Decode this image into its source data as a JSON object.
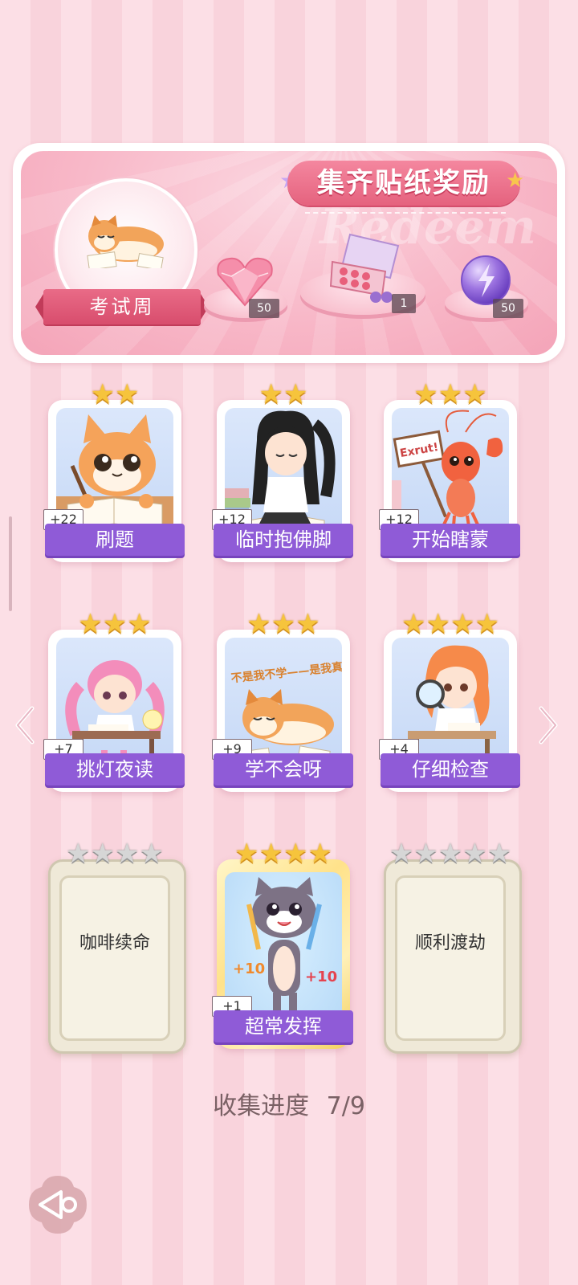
{
  "banner": {
    "title": "集齐贴纸奖励",
    "watermark": "Redeem",
    "event_label": "考试周",
    "rewards": [
      {
        "icon": "heart-gem-icon",
        "count": "50"
      },
      {
        "icon": "gift-box-icon",
        "count": "1"
      },
      {
        "icon": "energy-orb-icon",
        "count": "50"
      }
    ]
  },
  "cards": [
    {
      "name": "刷题",
      "bonus": "+22",
      "stars": 2,
      "art": "orange-cat-writing"
    },
    {
      "name": "临时抱佛脚",
      "bonus": "+12",
      "stars": 2,
      "art": "girl-studying-books"
    },
    {
      "name": "开始瞎蒙",
      "bonus": "+12",
      "stars": 3,
      "art": "lobster-sign"
    },
    {
      "name": "挑灯夜读",
      "bonus": "+7",
      "stars": 3,
      "art": "pink-girl-desk"
    },
    {
      "name": "学不会呀",
      "bonus": "+9",
      "stars": 3,
      "art": "shiba-lying",
      "art_text": "不是我不学——是我真不会呀"
    },
    {
      "name": "仔细检查",
      "bonus": "+4",
      "stars": 4,
      "art": "girl-magnifier"
    },
    {
      "name": "咖啡续命",
      "bonus": "",
      "stars": 4,
      "locked": true
    },
    {
      "name": "超常发挥",
      "bonus": "+1",
      "stars": 4,
      "art": "grey-cat-pencils",
      "art_text": "+10"
    },
    {
      "name": "顺利渡劫",
      "bonus": "",
      "stars": 5,
      "locked": true
    }
  ],
  "progress": {
    "label": "收集进度",
    "value": "7/9"
  },
  "colors": {
    "accent": "#8f5bd7",
    "pink": "#e5627e",
    "gold": "#f6c43c"
  }
}
